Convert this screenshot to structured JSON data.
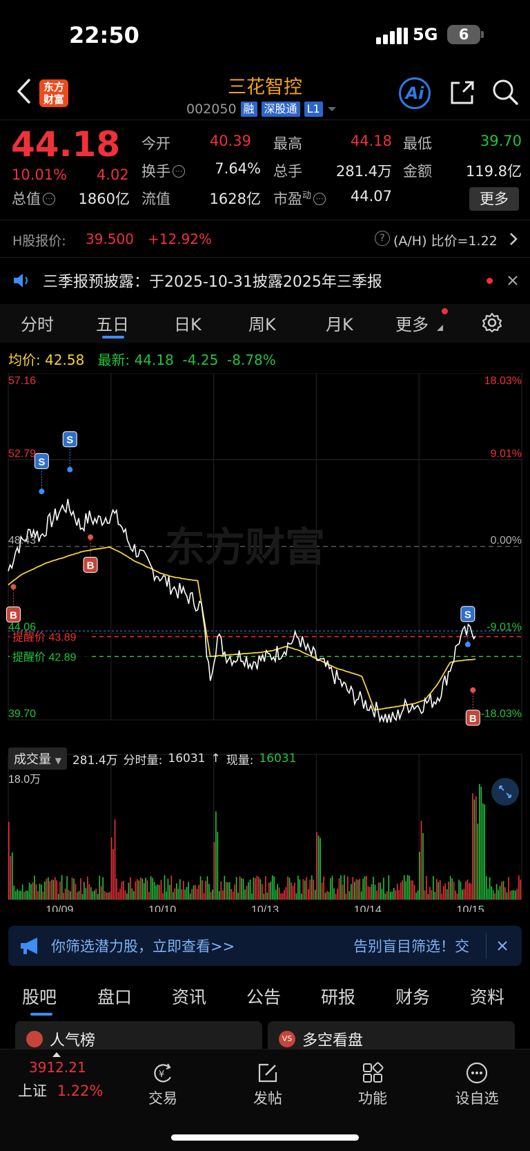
{
  "status": {
    "time": "22:50",
    "network": "5G",
    "battery": "6"
  },
  "header": {
    "logo_line1": "东方",
    "logo_line2": "财富",
    "stock_name": "三花智控",
    "stock_code": "002050",
    "tags": [
      "融",
      "深股通",
      "L1"
    ],
    "ai_label": "Ai"
  },
  "quote": {
    "price": "44.18",
    "change_pct": "10.01%",
    "change_amt": "4.02",
    "fields": {
      "open_label": "今开",
      "open": "40.39",
      "high_label": "最高",
      "high": "44.18",
      "low_label": "最低",
      "low": "39.70",
      "turnover_label": "换手",
      "turnover": "7.64%",
      "volume_label": "总手",
      "volume": "281.4万",
      "amount_label": "金额",
      "amount": "119.8亿",
      "mktcap_label": "总值",
      "mktcap": "1860亿",
      "float_label": "流值",
      "float": "1628亿",
      "pe_label": "市盈",
      "pe_sup": "动",
      "pe": "44.07"
    },
    "more_label": "更多"
  },
  "hshare": {
    "label": "H股报价:",
    "price": "39.500",
    "premium": "+12.92%",
    "ah_label": "(A/H) 比价=1.22"
  },
  "notice": {
    "text": "三季报预披露：于2025-10-31披露2025年三季报"
  },
  "chart_tabs": {
    "items": [
      "分时",
      "五日",
      "日K",
      "周K",
      "月K",
      "更多"
    ],
    "active": "五日"
  },
  "legend": {
    "avg_label": "均价:",
    "avg": "42.58",
    "last_label": "最新:",
    "last": "44.18",
    "chg": "-4.25",
    "pct": "-8.78%"
  },
  "chart_data": {
    "type": "line",
    "axis_left": [
      "57.16",
      "52.79",
      "48.43",
      "44.06",
      "39.70"
    ],
    "axis_right": [
      "18.03%",
      "9.01%",
      "0.00%",
      "-9.01%",
      "-18.03%"
    ],
    "ylim": [
      39.7,
      57.16
    ],
    "prev_close": 48.43,
    "x_labels": [
      "10/09",
      "10/10",
      "10/13",
      "10/14",
      "10/15"
    ],
    "alerts": [
      {
        "label": "提醒价",
        "value": "43.89",
        "color": "#f0313a"
      },
      {
        "label": "提醒价",
        "value": "42.89",
        "color": "#23c43c"
      }
    ],
    "watermark": "东方财富",
    "price_series": [
      {
        "name": "",
        "values": [
          47.2,
          48.3,
          48.8,
          49.3,
          48.9,
          49.6,
          50.0,
          50.5,
          50.2,
          49.4,
          49.9,
          49.7,
          49.9,
          50.1,
          49.5,
          48.6,
          48.2,
          47.7,
          47.2,
          46.9,
          46.5,
          46.2,
          46.0,
          45.7,
          45.4,
          41.8,
          43.9,
          43.0,
          42.8,
          43.0,
          42.6,
          42.7,
          42.8,
          43.0,
          43.2,
          43.6,
          43.9,
          43.2,
          42.9,
          42.5,
          42.1,
          41.7,
          41.2,
          40.9,
          40.6,
          40.4,
          40.1,
          39.8,
          39.7,
          40.3,
          40.5,
          40.4,
          40.6,
          40.7,
          41.4,
          42.5,
          43.8,
          44.1,
          44.18
        ]
      }
    ],
    "avg_series": [
      {
        "name": "",
        "values": [
          46.5,
          47.0,
          47.3,
          47.6,
          47.8,
          48.0,
          48.2,
          48.3,
          48.4,
          48.1,
          47.7,
          47.4,
          47.1,
          46.9,
          46.8,
          46.7,
          42.9,
          42.95,
          43.0,
          43.05,
          43.1,
          43.2,
          43.4,
          43.2,
          42.9,
          42.6,
          42.3,
          42.1,
          41.9,
          40.2,
          40.3,
          40.4,
          40.5,
          40.7,
          41.5,
          42.6,
          42.7,
          42.75
        ]
      }
    ],
    "markers": [
      {
        "label": "B",
        "value": 46.4
      },
      {
        "label": "S",
        "value": 51.2
      },
      {
        "label": "S",
        "value": 52.3
      },
      {
        "label": "B",
        "value": 48.9
      },
      {
        "label": "B",
        "value": 41.2
      },
      {
        "label": "S",
        "value": 43.5
      }
    ],
    "volume": {
      "header_label": "成交量",
      "total": "281.4万",
      "minute_label": "分时量:",
      "minute_value": "16031",
      "arrow": "↑",
      "current_label": "现量:",
      "current_value": "16031",
      "max_label": "18.0万"
    }
  },
  "ad": {
    "text": "你筛选潜力股，立即查看>>",
    "link": "告别盲目筛选！交"
  },
  "bottom_tabs": {
    "items": [
      "股吧",
      "盘口",
      "资讯",
      "公告",
      "研报",
      "财务",
      "资料"
    ],
    "active": "股吧"
  },
  "cards": {
    "left": "人气榜",
    "right": "多空看盘"
  },
  "nav": {
    "index_value": "3912.21",
    "index_name": "上证",
    "index_pct": "1.22%",
    "items": [
      "交易",
      "发帖",
      "功能",
      "设自选"
    ]
  }
}
